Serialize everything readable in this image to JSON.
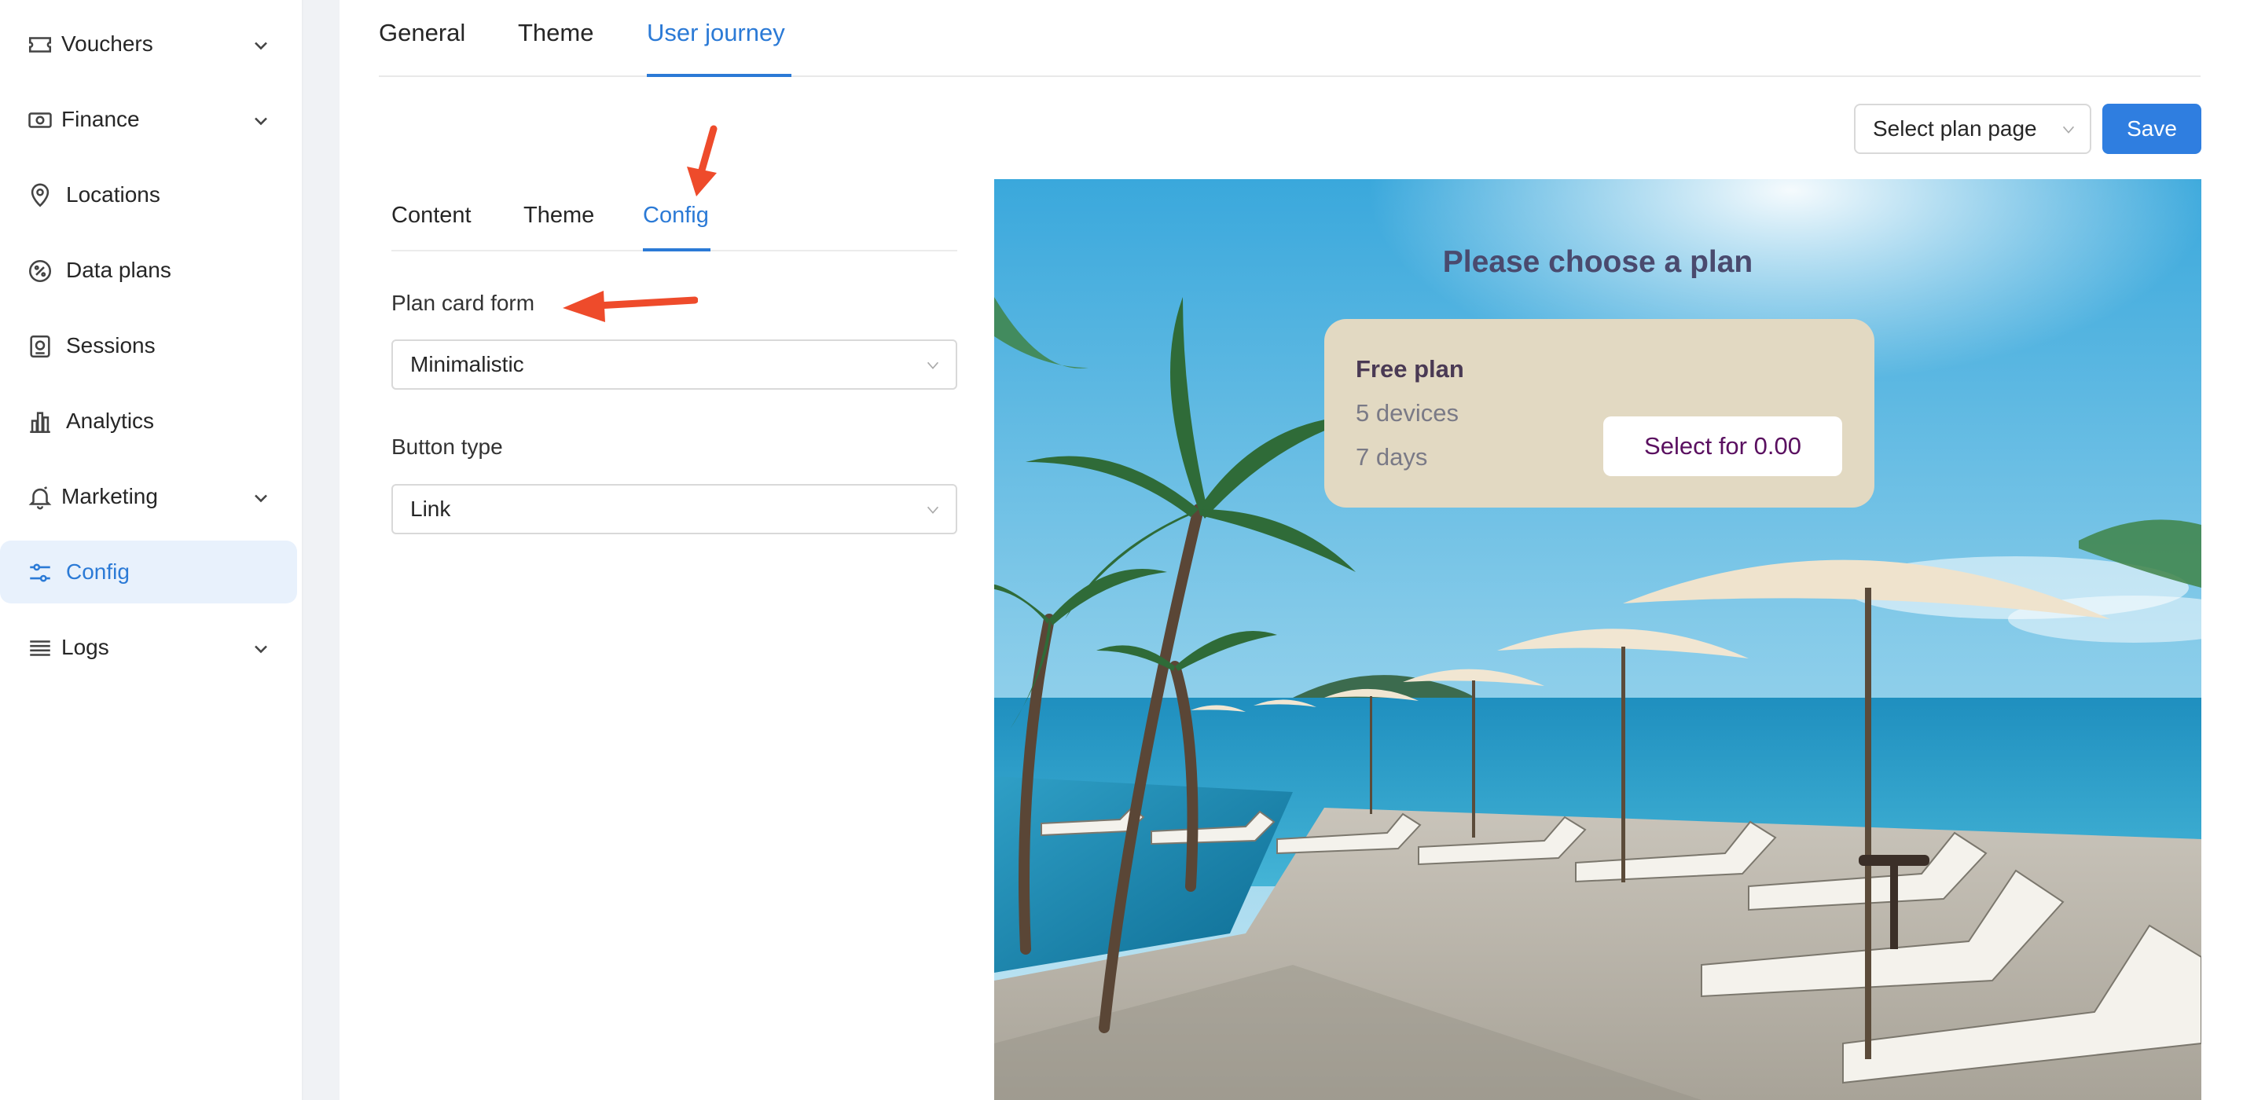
{
  "sidebar": {
    "items": [
      {
        "label": "Vouchers",
        "icon": "ticket-icon",
        "has_children": true
      },
      {
        "label": "Finance",
        "icon": "money-icon",
        "has_children": true
      },
      {
        "label": "Locations",
        "icon": "location-pin-icon",
        "has_children": false
      },
      {
        "label": "Data plans",
        "icon": "percent-badge-icon",
        "has_children": false
      },
      {
        "label": "Sessions",
        "icon": "session-icon",
        "has_children": false
      },
      {
        "label": "Analytics",
        "icon": "bar-chart-icon",
        "has_children": false
      },
      {
        "label": "Marketing",
        "icon": "bell-icon",
        "has_children": true
      },
      {
        "label": "Config",
        "icon": "sliders-icon",
        "has_children": false,
        "active": true
      },
      {
        "label": "Logs",
        "icon": "list-icon",
        "has_children": true
      }
    ]
  },
  "top_tabs": {
    "general": "General",
    "theme": "Theme",
    "user_journey": "User journey",
    "active": "User journey"
  },
  "toolbar": {
    "select_plan_page": "Select plan page",
    "save_label": "Save"
  },
  "sub_tabs": {
    "content": "Content",
    "theme": "Theme",
    "config": "Config",
    "active": "Config"
  },
  "form": {
    "plan_card_form_label": "Plan card form",
    "plan_card_form_value": "Minimalistic",
    "button_type_label": "Button type",
    "button_type_value": "Link"
  },
  "preview": {
    "title": "Please choose a plan",
    "plan": {
      "name": "Free plan",
      "devices": "5 devices",
      "days": "7 days",
      "button": "Select for 0.00"
    }
  },
  "colors": {
    "accent": "#2b7ad6",
    "save_button": "#2f7ee0",
    "active_nav_bg": "#e8f1fc",
    "annotation_arrow": "#ee4b2b",
    "plan_card_bg": "#e2d9c2",
    "plan_button_text": "#5a1060"
  }
}
